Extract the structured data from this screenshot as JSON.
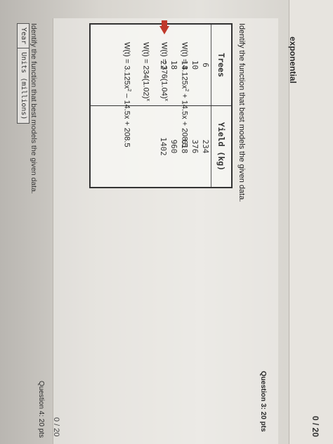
{
  "header": {
    "title": "exponential",
    "score": "0 / 20"
  },
  "question3": {
    "label": "Question 3: 20 pts",
    "prompt": "Identify the function that best models the given data.",
    "table": {
      "headers": [
        "Trees",
        "Yield (kg)"
      ],
      "trees": [
        "6",
        "10",
        "14",
        "18",
        "22"
      ],
      "yield": [
        "234",
        "376",
        "618",
        "960",
        "1402"
      ]
    },
    "options": {
      "a": {
        "pre": "W(t) = 3.125x",
        "sup": "2",
        "post": " + 14.5x + 208.5"
      },
      "b": {
        "pre": "W(t) = 376(1.04)",
        "sup": "x",
        "post": ""
      },
      "c": {
        "pre": "W(t) = 234(1.02)",
        "sup": "x",
        "post": ""
      },
      "d": {
        "pre": "W(t) = 3.125x",
        "sup": "2",
        "post": " – 14.5x + 208.5"
      }
    },
    "score": "0 / 20"
  },
  "question4": {
    "label": "Question 4: 20 pts",
    "prompt": "Identify the function that best models the given data.",
    "headers": [
      "Year",
      "Units (millions)"
    ]
  },
  "colors": {
    "selection_arrow": "#c0392b"
  }
}
